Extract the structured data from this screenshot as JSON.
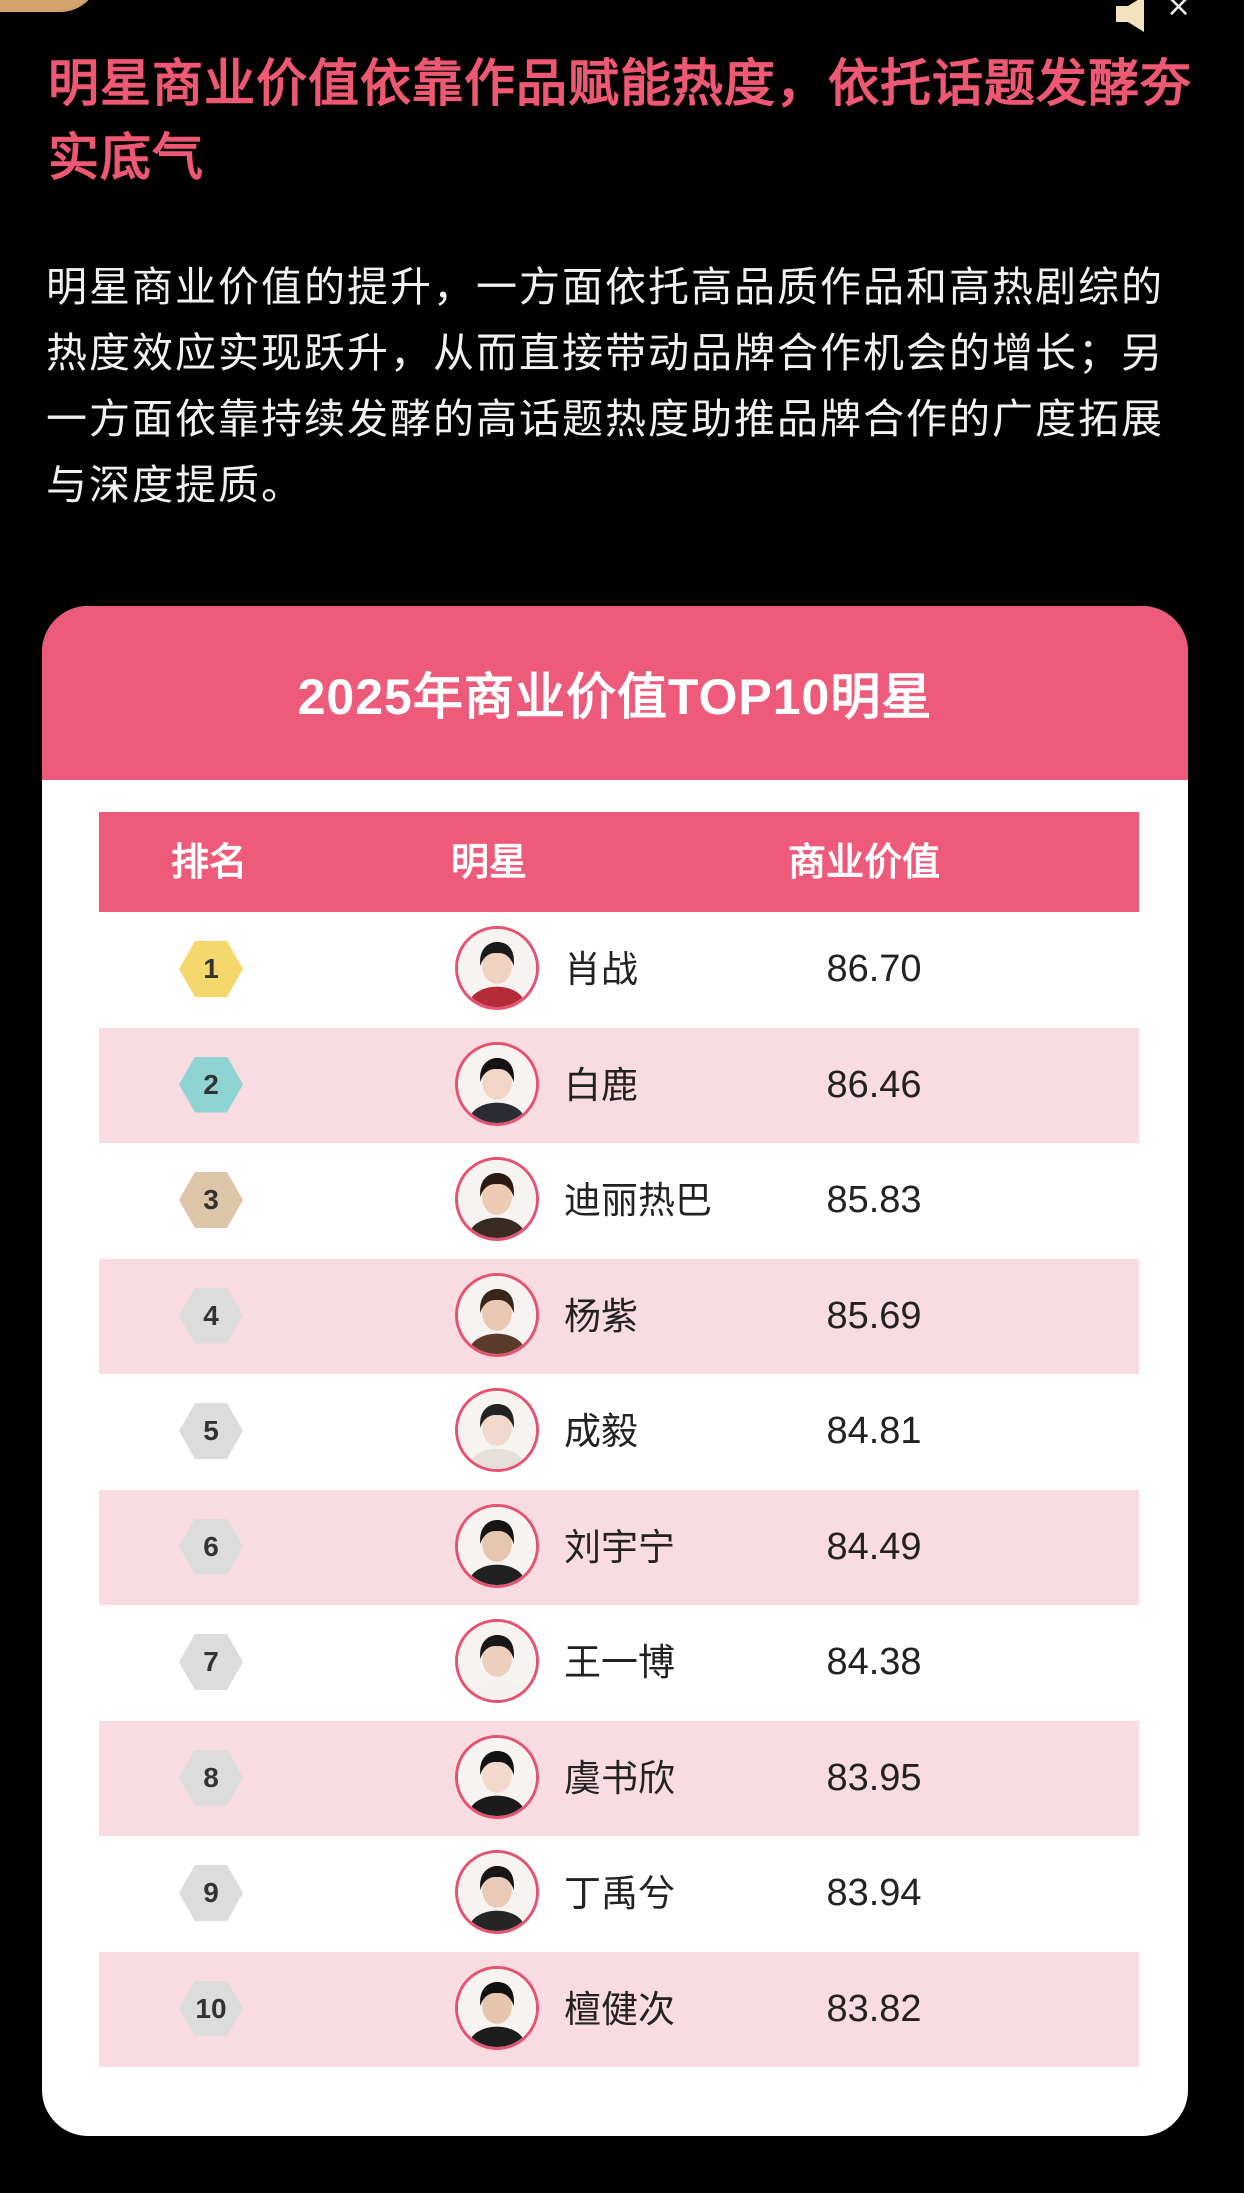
{
  "header": {
    "headline": "明星商业价值依靠作品赋能热度，依托话题发酵夯实底气",
    "body": "明星商业价值的提升，一方面依托高品质作品和高热剧综的热度效应实现跃升，从而直接带动品牌合作机会的增长；另一方面依靠持续发酵的高话题热度助推品牌合作的广度拓展与深度提质。"
  },
  "top_controls": {
    "close_symbol": "×",
    "speaker_icon": "speaker-icon",
    "close_icon": "close-icon"
  },
  "card": {
    "title": "2025年商业价值TOP10明星",
    "columns": [
      "排名",
      "明星",
      "商业价值"
    ],
    "rows": [
      {
        "rank": "1",
        "name": "肖战",
        "value": "86.70"
      },
      {
        "rank": "2",
        "name": "白鹿",
        "value": "86.46"
      },
      {
        "rank": "3",
        "name": "迪丽热巴",
        "value": "85.83"
      },
      {
        "rank": "4",
        "name": "杨紫",
        "value": "85.69"
      },
      {
        "rank": "5",
        "name": "成毅",
        "value": "84.81"
      },
      {
        "rank": "6",
        "name": "刘宇宁",
        "value": "84.49"
      },
      {
        "rank": "7",
        "name": "王一博",
        "value": "84.38"
      },
      {
        "rank": "8",
        "name": "虞书欣",
        "value": "83.95"
      },
      {
        "rank": "9",
        "name": "丁禹兮",
        "value": "83.94"
      },
      {
        "rank": "10",
        "name": "檀健次",
        "value": "83.82"
      }
    ]
  },
  "colors": {
    "accent": "#ee5b7a",
    "headline": "#ee5872",
    "row_stripe": "#f9dbe2",
    "gold": "#f4d86c",
    "silver": "#8fd4d3",
    "bronze": "#dcc5a9",
    "default_badge": "#dcdcdc"
  }
}
